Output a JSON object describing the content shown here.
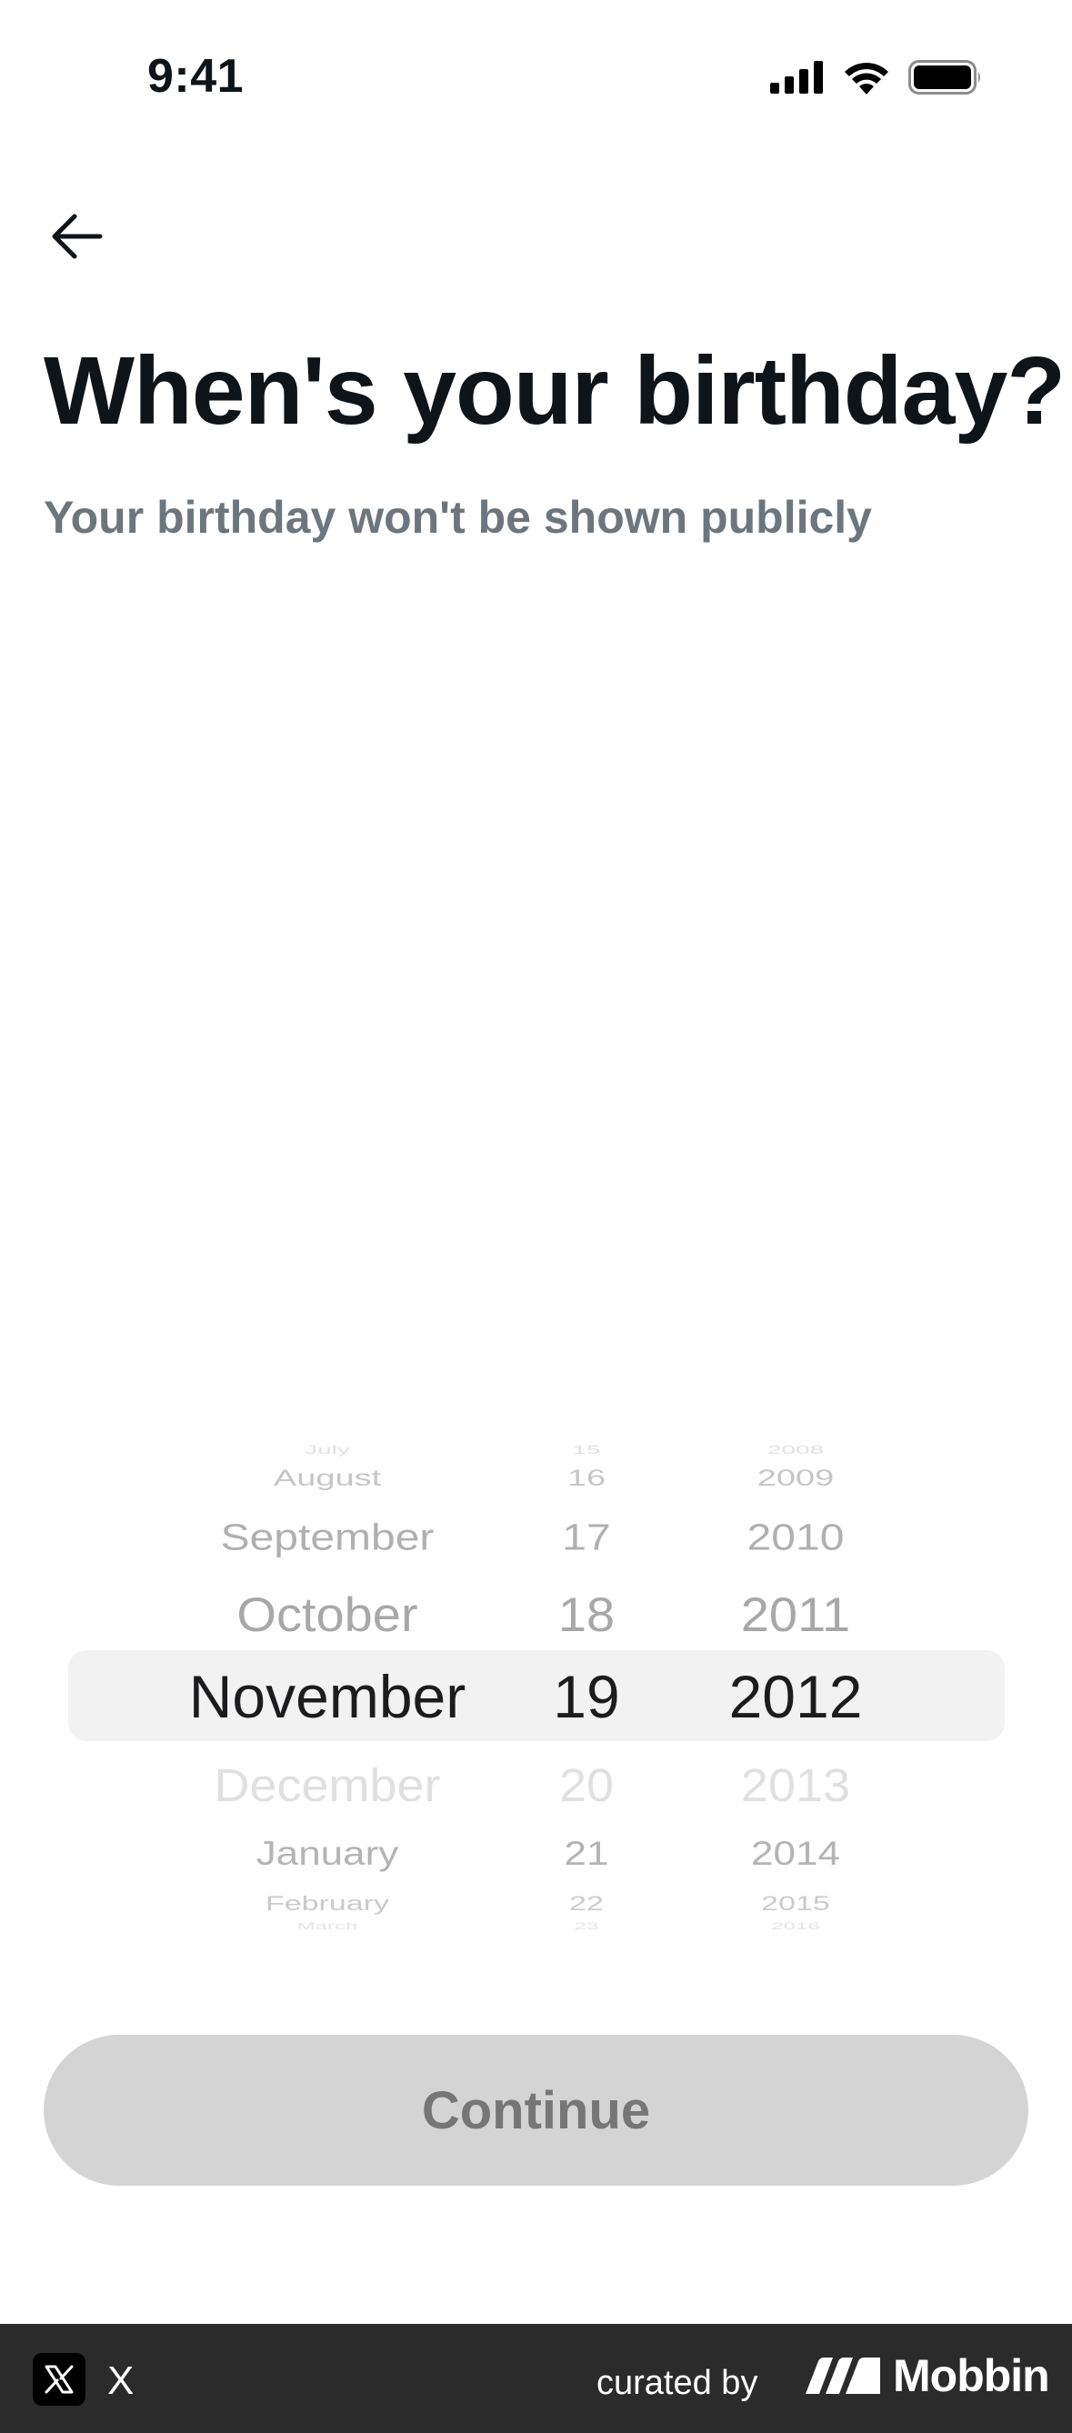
{
  "status_bar": {
    "time": "9:41"
  },
  "header": {
    "title": "When's your birthday?",
    "subtitle": "Your birthday won't be shown publicly"
  },
  "picker": {
    "month": {
      "items": [
        "July",
        "August",
        "September",
        "October",
        "November",
        "December",
        "January",
        "February",
        "March"
      ],
      "selected": "November"
    },
    "day": {
      "items": [
        "15",
        "16",
        "17",
        "18",
        "19",
        "20",
        "21",
        "22",
        "23"
      ],
      "selected": "19"
    },
    "year": {
      "items": [
        "2008",
        "2009",
        "2010",
        "2011",
        "2012",
        "2013",
        "2014",
        "2015",
        "2016"
      ],
      "selected": "2012"
    }
  },
  "actions": {
    "continue_label": "Continue"
  },
  "footer": {
    "app_name": "X",
    "curated_by": "curated by",
    "brand": "Mobbin"
  },
  "colors": {
    "text": "#0f1419",
    "subtitle": "#6e767d",
    "button_bg": "#d4d4d4",
    "button_text": "#767676",
    "picker_highlight": "#f2f2f2",
    "footer_bg": "#2b2b2b"
  },
  "icons": [
    "back-arrow-icon",
    "cellular-signal-icon",
    "wifi-icon",
    "battery-icon",
    "x-logo-icon",
    "mobbin-logo-icon"
  ]
}
